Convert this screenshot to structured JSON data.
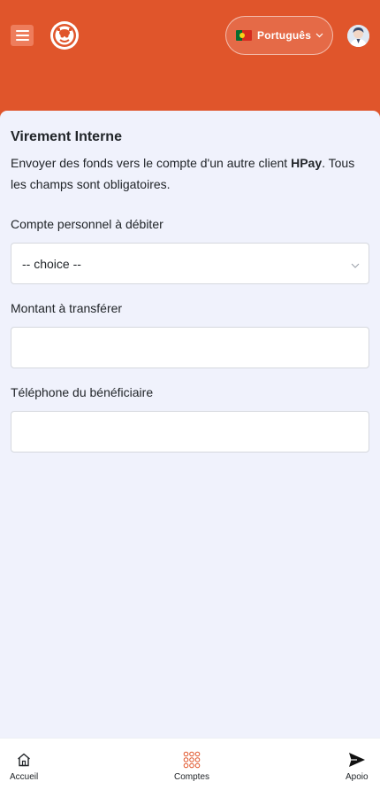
{
  "header": {
    "menu_icon": "hamburger-icon",
    "logo_icon": "brand-logo",
    "language": {
      "label": "Português",
      "flag": "portugal-flag-icon",
      "chevron": "chevron-down-icon"
    },
    "avatar_icon": "user-avatar",
    "brand_color": "#e0552b"
  },
  "form": {
    "title": "Virement Interne",
    "description_pre": "Envoyer des fonds vers le compte d'un autre client ",
    "description_brand": "HPay",
    "description_post": ". Tous les champs sont obligatoires.",
    "fields": [
      {
        "label": "Compte personnel à débiter",
        "value": "-- choice --",
        "type": "select"
      },
      {
        "label": "Montant à transférer",
        "value": "",
        "type": "input"
      },
      {
        "label": "Téléphone du bénéficiaire",
        "value": "",
        "type": "input"
      }
    ]
  },
  "bottom_nav": [
    {
      "label": "Accueil",
      "icon": "home-icon"
    },
    {
      "label": "Comptes",
      "icon": "grid-dots-icon"
    },
    {
      "label": "Apoio",
      "icon": "send-icon"
    }
  ]
}
